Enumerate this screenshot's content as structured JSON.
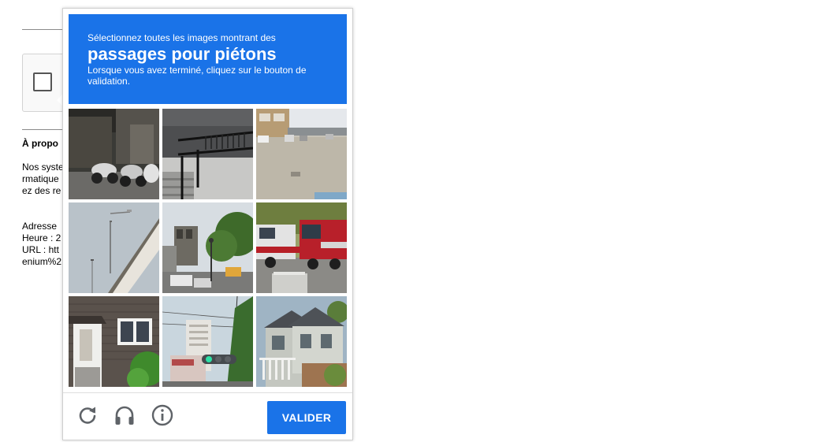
{
  "background_page": {
    "about_heading": "À propo",
    "body_lines": [
      "Nos syste",
      "rmatique",
      "ez des re"
    ],
    "info_lines": [
      "Adresse",
      "Heure : 2",
      "URL : htt",
      "enium%2"
    ]
  },
  "challenge": {
    "instruction_line1": "Sélectionnez toutes les images montrant des",
    "target_object": "passages pour piétons",
    "instruction_line3": "Lorsque vous avez terminé, cliquez sur le bouton de validation.",
    "header_color": "#1a73e8",
    "tiles": [
      {
        "icon": "storefront-motorcycles"
      },
      {
        "icon": "stairs-railing"
      },
      {
        "icon": "parking-lot"
      },
      {
        "icon": "roof-streetlight"
      },
      {
        "icon": "street-trees"
      },
      {
        "icon": "red-trucks"
      },
      {
        "icon": "house-door"
      },
      {
        "icon": "traffic-light"
      },
      {
        "icon": "houses"
      }
    ]
  },
  "footer": {
    "reload_icon": "reload-icon",
    "audio_icon": "headphones-icon",
    "info_icon": "info-icon",
    "verify_label": "VALIDER",
    "verify_color": "#1a73e8"
  }
}
